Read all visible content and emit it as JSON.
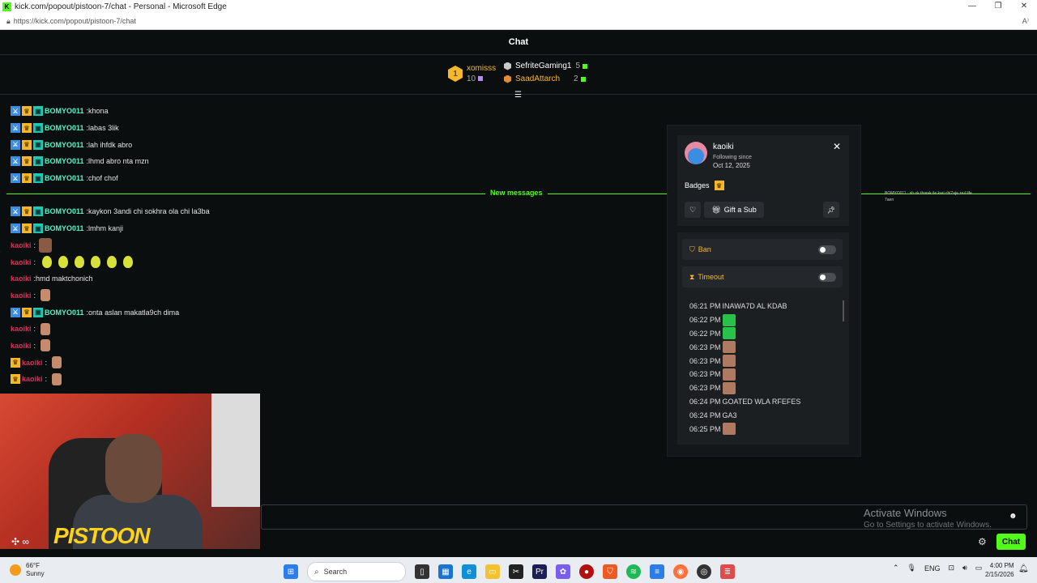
{
  "window": {
    "title": "kick.com/popout/pistoon-7/chat - Personal - Microsoft Edge",
    "url": "https://kick.com/popout/pistoon-7/chat",
    "controls": [
      "—",
      "❐",
      "✕"
    ]
  },
  "header": {
    "title": "Chat"
  },
  "gifters": {
    "top": {
      "rank": "1",
      "name": "xomisss",
      "count": "10"
    },
    "others": [
      {
        "name": "SefriteGaming1",
        "count": "5"
      },
      {
        "name": "SaadAttarch",
        "count": "2"
      }
    ]
  },
  "messages_before": [
    {
      "user": "BOMYO011",
      "text": "khona"
    },
    {
      "user": "BOMYO011",
      "text": "labas 3lik"
    },
    {
      "user": "BOMYO011",
      "text": "lah ihfdk abro"
    },
    {
      "user": "BOMYO011",
      "text": "lhmd abro nta mzn"
    },
    {
      "user": "BOMYO011",
      "text": "chof chof"
    }
  ],
  "new_messages_label": "New messages",
  "messages_after": [
    {
      "user": "BOMYO011",
      "text": "kaykon 3andi chi sokhra ola chi la3ba",
      "type": "sub"
    },
    {
      "user": "BOMYO011",
      "text": "lmhm kanji",
      "type": "sub"
    },
    {
      "user": "kaoiki",
      "text": "",
      "type": "face"
    },
    {
      "user": "kaoiki",
      "text": "",
      "type": "pears"
    },
    {
      "user": "kaoiki",
      "text": "hmd maktchonich",
      "type": "plain"
    },
    {
      "user": "kaoiki",
      "text": "",
      "type": "emote"
    },
    {
      "user": "BOMYO011",
      "text": "onta aslan makatla9ch dima",
      "type": "sub"
    },
    {
      "user": "kaoiki",
      "text": "",
      "type": "emote"
    },
    {
      "user": "kaoiki",
      "text": "",
      "type": "emote"
    },
    {
      "user": "kaoiki",
      "text": "",
      "type": "crown-emote"
    },
    {
      "user": "kaoiki",
      "text": "",
      "type": "crown-emote"
    }
  ],
  "right_preview": {
    "line1": "BOMYO011 : sh ok thanık ile kari chi7aja zeıl life",
    "line2": "7aen"
  },
  "user_card": {
    "name": "kaoiki",
    "following_label": "Following since",
    "following_date": "Oct 12, 2025",
    "badges_label": "Badges",
    "gift_label": "Gift a Sub",
    "ban_label": "Ban",
    "timeout_label": "Timeout",
    "log": [
      {
        "time": "06:21 PM",
        "text": "INAWA7D AL KDAB",
        "emote": ""
      },
      {
        "time": "06:22 PM",
        "text": "",
        "emote": "green"
      },
      {
        "time": "06:22 PM",
        "text": "",
        "emote": "green"
      },
      {
        "time": "06:23 PM",
        "text": "",
        "emote": "face"
      },
      {
        "time": "06:23 PM",
        "text": "",
        "emote": "face"
      },
      {
        "time": "06:23 PM",
        "text": "",
        "emote": "face"
      },
      {
        "time": "06:23 PM",
        "text": "",
        "emote": "face"
      },
      {
        "time": "06:24 PM",
        "text": "GOATED WLA RFEFES",
        "emote": ""
      },
      {
        "time": "06:24 PM",
        "text": "GA3",
        "emote": ""
      },
      {
        "time": "06:25 PM",
        "text": "",
        "emote": "face"
      }
    ]
  },
  "webcam": {
    "logo": "PISTOON"
  },
  "activate_windows": {
    "title": "Activate Windows",
    "subtitle": "Go to Settings to activate Windows."
  },
  "chat_button": "Chat",
  "taskbar": {
    "weather_temp": "66°F",
    "weather_desc": "Sunny",
    "search_placeholder": "Search",
    "lang": "ENG",
    "time": "4:00 PM",
    "date": "2/15/2026"
  },
  "colors": {
    "accent": "#53fc18",
    "gifter_gold": "#f5b82a",
    "username_sub": "#53f5c3",
    "username_kaoiki": "#d9315a"
  }
}
